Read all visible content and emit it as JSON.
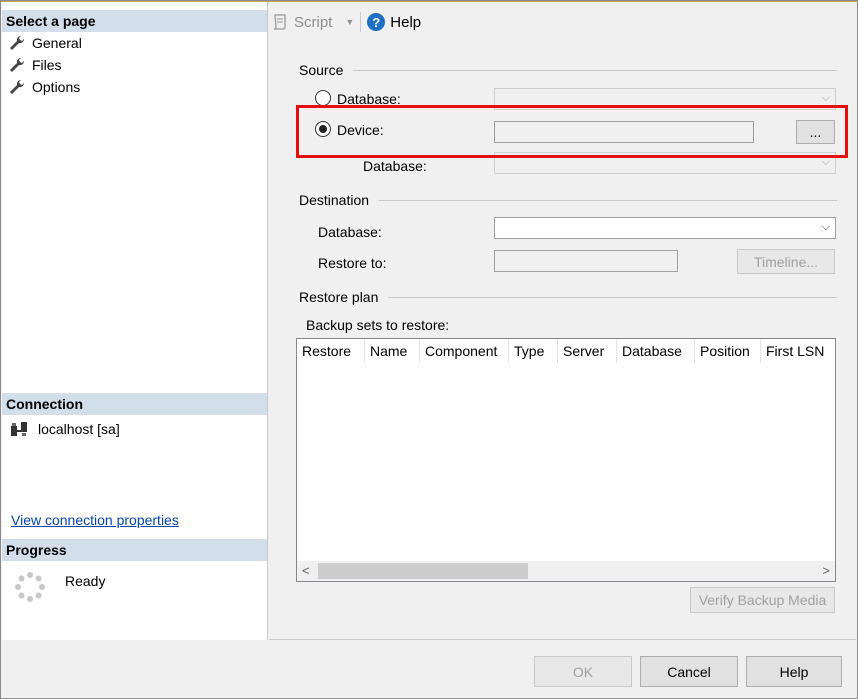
{
  "left_panel": {
    "select_page_header": "Select a page",
    "pages": [
      {
        "label": "General",
        "icon": "wrench-icon"
      },
      {
        "label": "Files",
        "icon": "wrench-icon"
      },
      {
        "label": "Options",
        "icon": "wrench-icon"
      }
    ],
    "connection_header": "Connection",
    "connection_item": "localhost [sa]",
    "view_connection_link": "View connection properties",
    "progress_header": "Progress",
    "progress_status": "Ready"
  },
  "toolbar": {
    "script_label": "Script",
    "help_label": "Help"
  },
  "source": {
    "title": "Source",
    "database_radio_label": "Database:",
    "device_radio_label": "Device:",
    "device_value": "",
    "browse_button": "...",
    "device_database_label": "Database:",
    "selected": "device"
  },
  "destination": {
    "title": "Destination",
    "database_label": "Database:",
    "database_value": "",
    "restore_to_label": "Restore to:",
    "restore_to_value": "",
    "timeline_button": "Timeline..."
  },
  "restore_plan": {
    "title": "Restore plan",
    "backup_sets_label": "Backup sets to restore:",
    "columns": [
      "Restore",
      "Name",
      "Component",
      "Type",
      "Server",
      "Database",
      "Position",
      "First LSN"
    ],
    "verify_button": "Verify Backup Media"
  },
  "footer": {
    "ok_button": "OK",
    "cancel_button": "Cancel",
    "help_button": "Help"
  },
  "colors": {
    "section_header_bg": "#d2dfeb",
    "highlight": "#e41010",
    "link": "#0645ad"
  }
}
